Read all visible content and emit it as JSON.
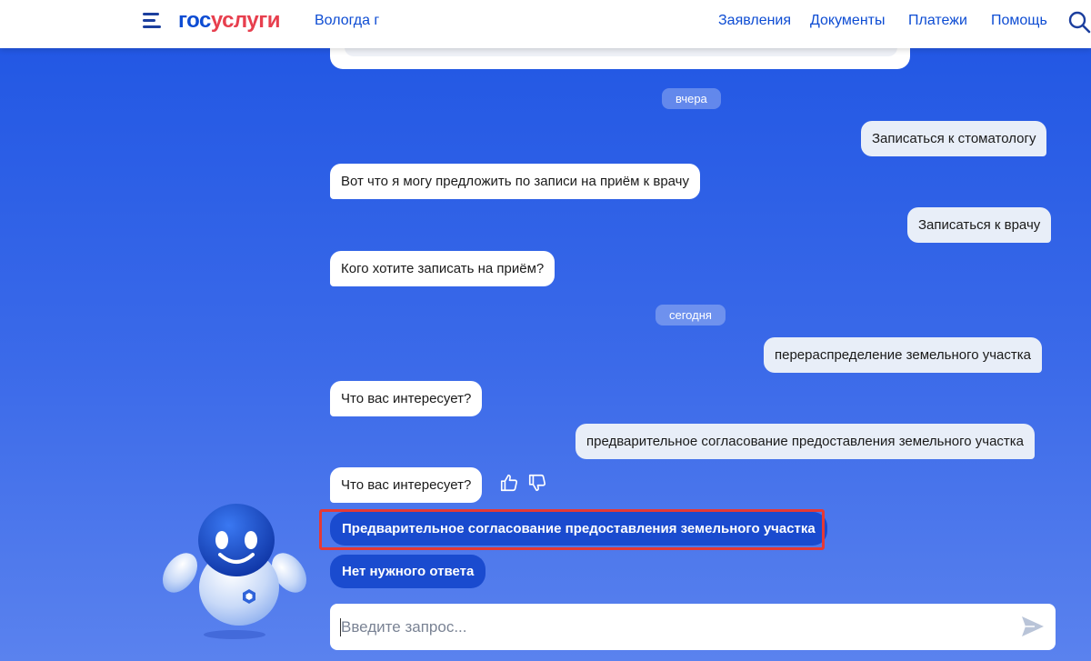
{
  "header": {
    "logo_part1": "гос",
    "logo_part2": "услуги",
    "city": "Вологда г",
    "nav": [
      "Заявления",
      "Документы",
      "Платежи",
      "Помощь"
    ]
  },
  "chat": {
    "dates": {
      "yesterday": "вчера",
      "today": "сегодня"
    },
    "messages": [
      {
        "from": "user",
        "text": "Записаться к стоматологу"
      },
      {
        "from": "bot",
        "text": "Вот что я могу предложить по записи на приём к врачу"
      },
      {
        "from": "user",
        "text": "Записаться к врачу"
      },
      {
        "from": "bot",
        "text": "Кого хотите записать на приём?"
      },
      {
        "from": "user",
        "text": "перераспределение земельного участка"
      },
      {
        "from": "bot",
        "text": "Что вас интересует?"
      },
      {
        "from": "user",
        "text": "предварительное согласование предоставления земельного участка"
      },
      {
        "from": "bot",
        "text": "Что вас интересует?"
      }
    ],
    "options": [
      "Предварительное согласование предоставления земельного участка",
      "Нет нужного ответа"
    ]
  },
  "input": {
    "placeholder": "Введите запрос..."
  },
  "colors": {
    "brand_blue": "#0d4cd3",
    "brand_red": "#e73f4e",
    "option_bg": "#1a4bcf",
    "highlight": "#e53935"
  },
  "icons": [
    "burger-menu-icon",
    "search-icon",
    "thumbs-up-icon",
    "thumbs-down-icon",
    "send-icon",
    "robot-assistant"
  ]
}
